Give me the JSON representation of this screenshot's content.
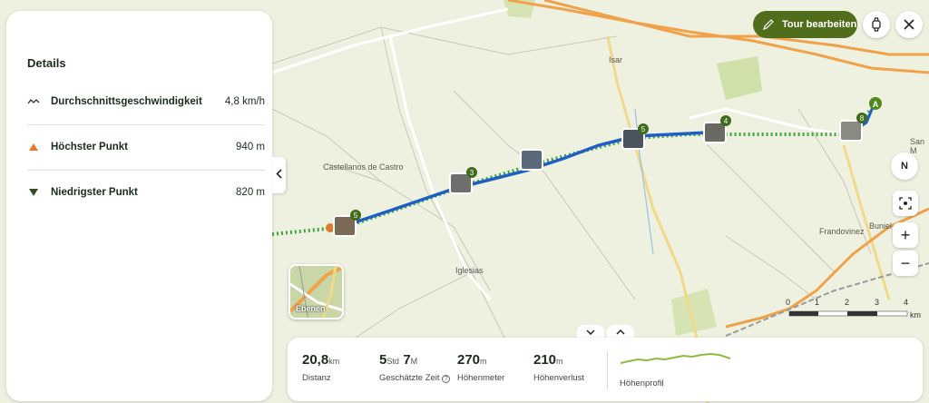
{
  "details": {
    "title": "Details",
    "rows": [
      {
        "label": "Durchschnittsgeschwindigkeit",
        "value": "4,8 km/h",
        "icon": "speed-wave-icon"
      },
      {
        "label": "Höchster Punkt",
        "value": "940 m",
        "icon": "triangle-up-icon"
      },
      {
        "label": "Niedrigster Punkt",
        "value": "820 m",
        "icon": "triangle-down-icon"
      }
    ]
  },
  "toolbar": {
    "edit_label": "Tour bearbeiten"
  },
  "map": {
    "places": [
      "Castellanos de Castro",
      "Isar",
      "Iglesias",
      "Frandovinez",
      "Buniel",
      "San M"
    ],
    "waypoint_counts": [
      "5",
      "3",
      "5",
      "4",
      "8"
    ],
    "start_marker": "A",
    "compass": "N",
    "layers_label": "Ebenen",
    "scale_ticks": [
      "0",
      "1",
      "2",
      "3",
      "4"
    ],
    "scale_unit": "km",
    "route_color": "#1f5fc4",
    "accent_green": "#4f6d1a"
  },
  "stats": {
    "distance": {
      "value": "20,8",
      "unit": "km",
      "label": "Distanz"
    },
    "time": {
      "hours": "5",
      "hours_unit": "Std",
      "minutes": "7",
      "minutes_unit": "M",
      "label": "Geschätzte Zeit"
    },
    "ascent": {
      "value": "270",
      "unit": "m",
      "label": "Höhenmeter"
    },
    "descent": {
      "value": "210",
      "unit": "m",
      "label": "Höhenverlust"
    },
    "profile_label": "Höhenprofil"
  }
}
